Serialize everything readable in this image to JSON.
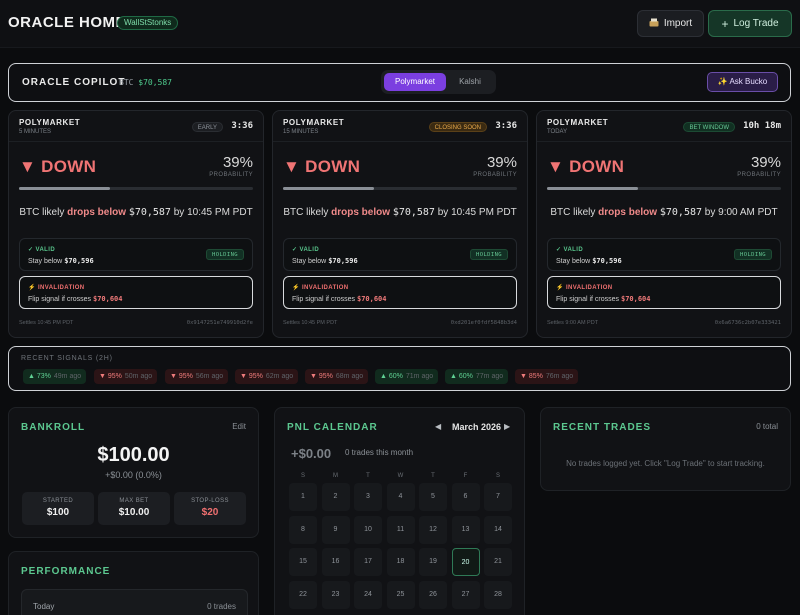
{
  "header": {
    "title": "ORACLE HOME",
    "user_badge": "WallStStonks",
    "import_label": "Import",
    "log_trade_label": "Log Trade",
    "import_icon": "inbox-tray-icon",
    "log_icon": "plus-icon"
  },
  "copilot": {
    "title": "ORACLE COPILOT",
    "btc_label": "BTC",
    "btc_price": "$70,587",
    "tabs": [
      "Polymarket",
      "Kalshi"
    ],
    "active_tab": "Polymarket",
    "ask_label": "✨ Ask Bucko"
  },
  "markets": [
    {
      "source": "POLYMARKET",
      "timeframe": "5 MINUTES",
      "badge": "EARLY",
      "time": "3:36",
      "direction": "▼ DOWN",
      "probability": "39%",
      "prob_label": "PROBABILITY",
      "prob_value": 0.39,
      "summary_pre": "BTC likely",
      "summary_bold": "drops below",
      "summary_price": "$70,587",
      "summary_post": "by 10:45 PM PDT",
      "valid_title": "✓ VALID",
      "valid_pre": "Stay below",
      "valid_price": "$70,596",
      "hold": "HOLDING",
      "inval_title": "⚡ INVALIDATION",
      "inval_pre": "Flip signal if crosses",
      "inval_price": "$70,604",
      "settles": "Settles 10:45 PM PDT",
      "hash": "0x9147251e749910d2fe"
    },
    {
      "source": "POLYMARKET",
      "timeframe": "15 MINUTES",
      "badge": "CLOSING SOON",
      "time": "3:36",
      "direction": "▼ DOWN",
      "probability": "39%",
      "prob_label": "PROBABILITY",
      "prob_value": 0.39,
      "summary_pre": "BTC likely",
      "summary_bold": "drops below",
      "summary_price": "$70,587",
      "summary_post": "by 10:45 PM PDT",
      "valid_title": "✓ VALID",
      "valid_pre": "Stay below",
      "valid_price": "$70,596",
      "hold": "HOLDING",
      "inval_title": "⚡ INVALIDATION",
      "inval_pre": "Flip signal if crosses",
      "inval_price": "$70,604",
      "settles": "Settles 10:45 PM PDT",
      "hash": "0xd201ef0fdf5848b3d4"
    },
    {
      "source": "POLYMARKET",
      "timeframe": "TODAY",
      "badge": "BET WINDOW",
      "time": "10h 18m",
      "direction": "▼ DOWN",
      "probability": "39%",
      "prob_label": "PROBABILITY",
      "prob_value": 0.39,
      "summary_pre": "BTC likely",
      "summary_bold": "drops below",
      "summary_price": "$70,587",
      "summary_post": "by 9:00 AM PDT",
      "valid_title": "✓ VALID",
      "valid_pre": "Stay below",
      "valid_price": "$70,596",
      "hold": "HOLDING",
      "inval_title": "⚡ INVALIDATION",
      "inval_pre": "Flip signal if crosses",
      "inval_price": "$70,604",
      "settles": "Settles 9:00 AM PDT",
      "hash": "0x6a6736c2b07e333421"
    }
  ],
  "signals": {
    "title": "RECENT SIGNALS (2H)",
    "items": [
      {
        "dir": "up",
        "label": "▲ 73%",
        "ago": "49m ago"
      },
      {
        "dir": "down",
        "label": "▼ 95%",
        "ago": "50m ago"
      },
      {
        "dir": "down",
        "label": "▼ 95%",
        "ago": "56m ago"
      },
      {
        "dir": "down",
        "label": "▼ 95%",
        "ago": "62m ago"
      },
      {
        "dir": "down",
        "label": "▼ 95%",
        "ago": "68m ago"
      },
      {
        "dir": "up",
        "label": "▲ 60%",
        "ago": "71m ago"
      },
      {
        "dir": "up",
        "label": "▲ 60%",
        "ago": "77m ago"
      },
      {
        "dir": "down",
        "label": "▼ 85%",
        "ago": "76m ago"
      }
    ]
  },
  "bankroll": {
    "title": "BANKROLL",
    "edit_label": "Edit",
    "balance": "$100.00",
    "pnl": "+$0.00 (0.0%)",
    "stats": [
      {
        "label": "STARTED",
        "value": "$100"
      },
      {
        "label": "MAX BET",
        "value": "$10.00"
      },
      {
        "label": "STOP-LOSS",
        "value": "$20"
      }
    ]
  },
  "performance": {
    "title": "PERFORMANCE",
    "row_label": "Today",
    "row_value": "0 trades"
  },
  "calendar": {
    "title": "PNL CALENDAR",
    "month": "March 2026",
    "prev_icon": "◀",
    "next_icon": "▶",
    "total": "+$0.00",
    "count": "0 trades this month",
    "weekdays": [
      "S",
      "M",
      "T",
      "W",
      "T",
      "F",
      "S"
    ],
    "days": [
      "1",
      "2",
      "3",
      "4",
      "5",
      "6",
      "7",
      "8",
      "9",
      "10",
      "11",
      "12",
      "13",
      "14",
      "15",
      "16",
      "17",
      "18",
      "19",
      "20",
      "21",
      "22",
      "23",
      "24",
      "25",
      "26",
      "27",
      "28"
    ],
    "today": "20"
  },
  "trades": {
    "title": "RECENT TRADES",
    "total": "0 total",
    "empty": "No trades logged yet. Click \"Log Trade\" to start tracking."
  }
}
